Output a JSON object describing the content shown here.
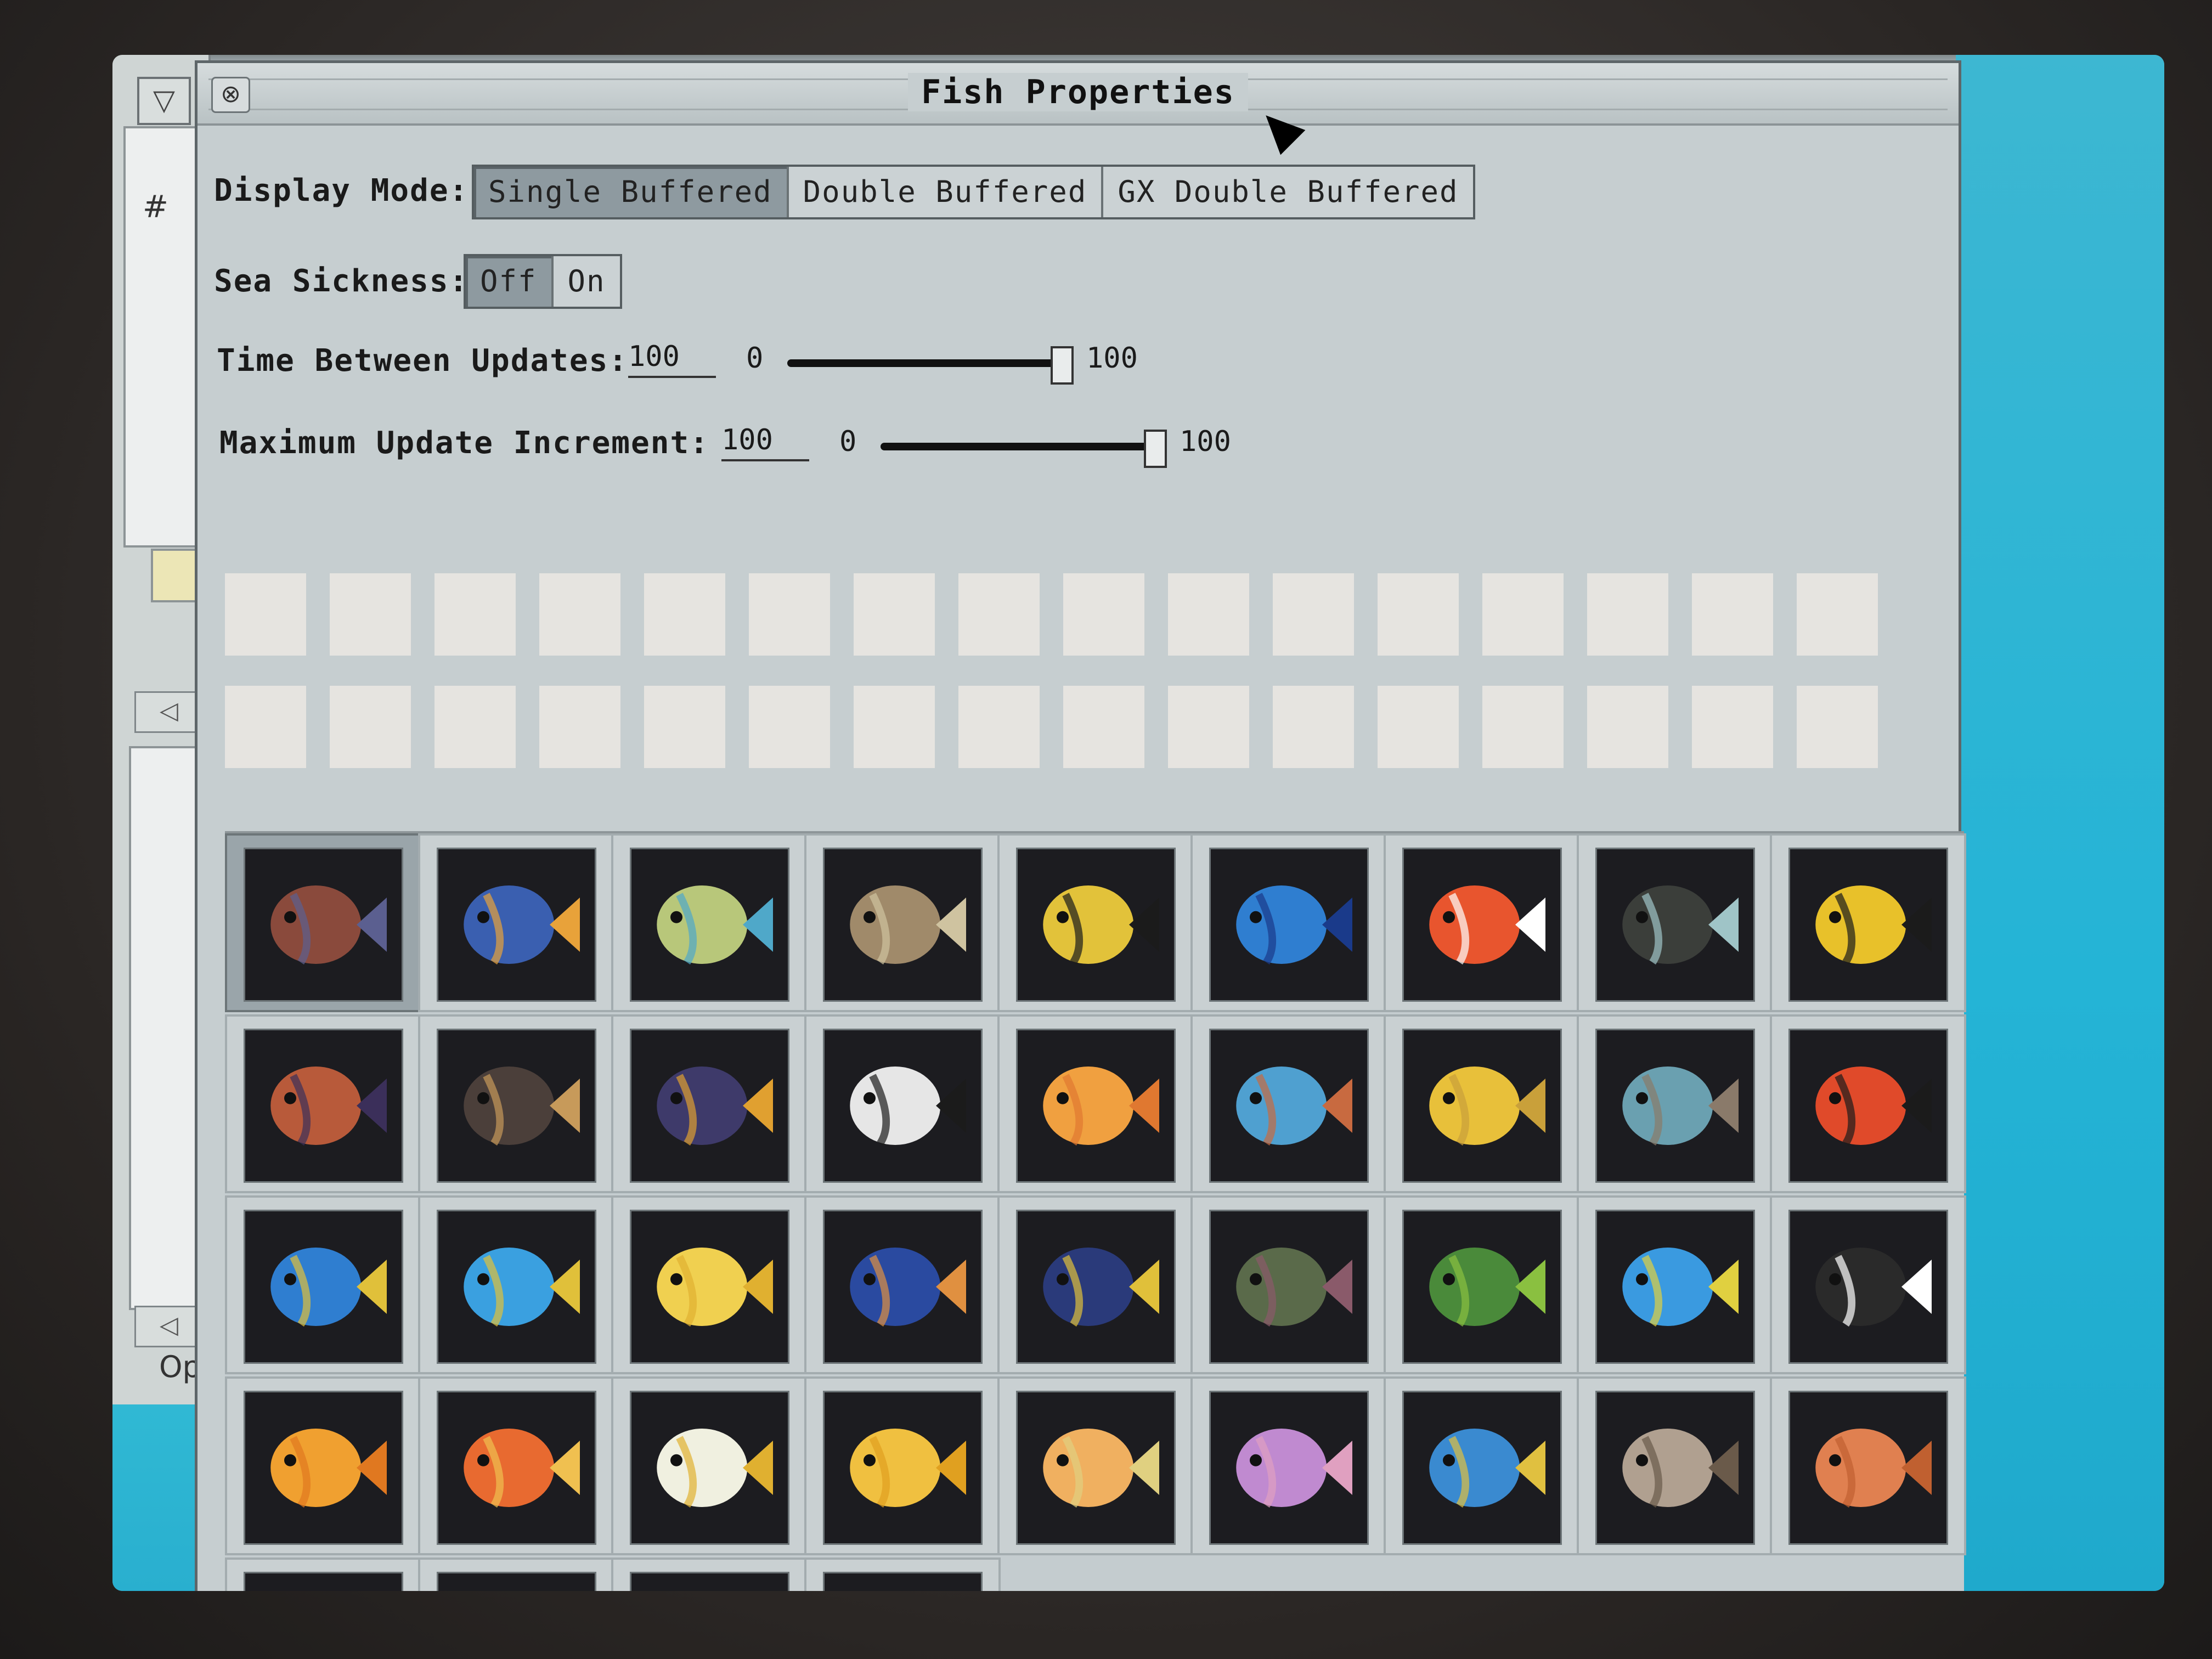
{
  "window": {
    "title": "Fish Properties"
  },
  "display_mode": {
    "label": "Display Mode:",
    "options": [
      "Single Buffered",
      "Double Buffered",
      "GX Double Buffered"
    ],
    "selected": "Single Buffered"
  },
  "sea_sickness": {
    "label": "Sea Sickness:",
    "options": [
      "Off",
      "On"
    ],
    "selected": "Off"
  },
  "time_between_updates": {
    "label": "Time Between Updates:",
    "value": "100",
    "min": "0",
    "max": "100",
    "level": 1.0
  },
  "max_update_increment": {
    "label": "Maximum Update Increment:",
    "value": "100",
    "min": "0",
    "max": "100",
    "level": 1.0
  },
  "background_window": {
    "partial_label": "Op",
    "hash": "#"
  },
  "empty_slot_rows": 2,
  "empty_slots_per_row": 16,
  "fish_palette": [
    [
      "#8a4a3c",
      "#5b5f90"
    ],
    [
      "#3a5fb0",
      "#e8a23a"
    ],
    [
      "#b8c77a",
      "#4fa8c9"
    ],
    [
      "#a08a6a",
      "#cfc3a0"
    ],
    [
      "#e2c23a",
      "#1b1b1b"
    ],
    [
      "#2f7ed0",
      "#1a3a8a"
    ],
    [
      "#e8552e",
      "#ffffff"
    ],
    [
      "#3b3e3a",
      "#9fc4c7"
    ],
    [
      "#e8c12a",
      "#1b1b1b"
    ],
    [
      "#b85a3a",
      "#3b2f5a"
    ],
    [
      "#4b3f3a",
      "#c79a5a"
    ],
    [
      "#3e3a6a",
      "#e0a030"
    ],
    [
      "#e6e6e6",
      "#1b1b1b"
    ],
    [
      "#f0a040",
      "#e07830"
    ],
    [
      "#4fa0d0",
      "#c86a40"
    ],
    [
      "#e8c03a",
      "#c9a03a"
    ],
    [
      "#6aa0b0",
      "#8a7a6a"
    ],
    [
      "#e04a2a",
      "#1b1b1b"
    ],
    [
      "#2f7ed0",
      "#e0c03a"
    ],
    [
      "#3aa0e0",
      "#e0c03a"
    ],
    [
      "#f0d050",
      "#e0b030"
    ],
    [
      "#2a4aa0",
      "#e09040"
    ],
    [
      "#2a3a7a",
      "#e0c03a"
    ],
    [
      "#5a6a4a",
      "#8a5a6a"
    ],
    [
      "#4a8a3a",
      "#8ac040"
    ],
    [
      "#3a9ae0",
      "#e0d040"
    ],
    [
      "#2a2a2a",
      "#ffffff"
    ],
    [
      "#f0a030",
      "#e07820"
    ],
    [
      "#e86a30",
      "#f0c050"
    ],
    [
      "#f0f0e0",
      "#e0b030"
    ],
    [
      "#f0c040",
      "#e0a020"
    ],
    [
      "#f0b060",
      "#e0d080"
    ],
    [
      "#c08ad0",
      "#e0a0c0"
    ],
    [
      "#3a8ad0",
      "#e0c040"
    ],
    [
      "#b0a090",
      "#6a5a4a"
    ],
    [
      "#e08050",
      "#c06030"
    ],
    [
      "#e0e0e0",
      "#b0a080"
    ],
    [
      "#c0b0a0",
      "#7a6a5a"
    ],
    [
      "#6a7a8a",
      "#a0b0c0"
    ],
    [
      "#c0c0c0",
      "#8a8a8a"
    ]
  ]
}
